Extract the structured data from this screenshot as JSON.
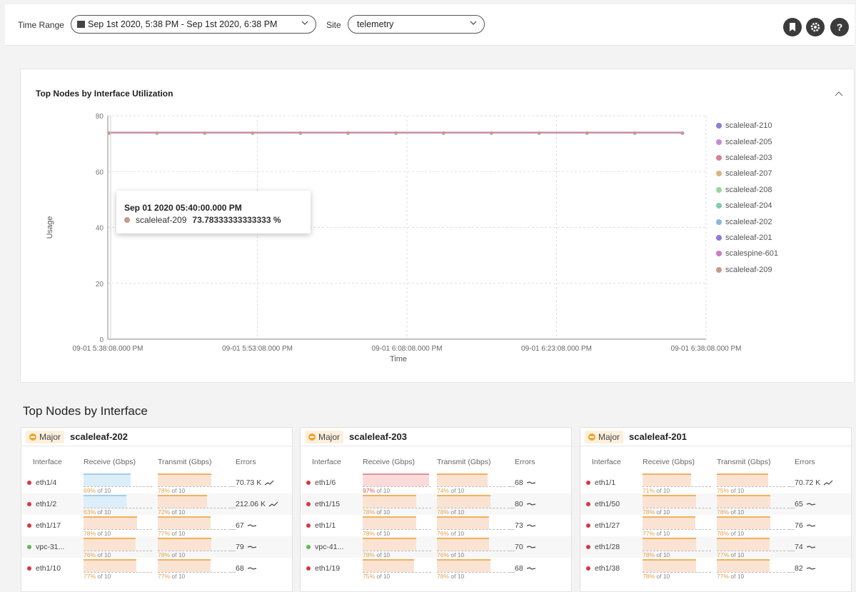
{
  "header": {
    "time_range_label": "Time Range",
    "time_range_value": "Sep 1st 2020, 5:38 PM - Sep 1st 2020, 6:38 PM",
    "site_label": "Site",
    "site_value": "telemetry",
    "icons": [
      "bookmark-icon",
      "gear-icon",
      "help-icon"
    ]
  },
  "chart_card": {
    "title": "Top Nodes by Interface Utilization"
  },
  "chart_data": {
    "type": "line",
    "xlabel": "Time",
    "ylabel": "Usage",
    "ylim": [
      0,
      80
    ],
    "yticks": [
      0,
      20,
      40,
      60,
      80
    ],
    "xticks": [
      "09-01 5:38:08.000 PM",
      "09-01 5:53:08.000 PM",
      "09-01 6:08:08.000 PM",
      "09-01 6:23:08.000 PM",
      "09-01 6:38:08.000 PM"
    ],
    "grid": true,
    "legend_position": "right",
    "x": [
      "5:38:08 PM",
      "5:40:00 PM",
      "5:45:00 PM",
      "5:50:00 PM",
      "5:55:00 PM",
      "6:00:00 PM",
      "6:05:00 PM",
      "6:10:00 PM",
      "6:15:00 PM",
      "6:20:00 PM",
      "6:25:00 PM",
      "6:30:00 PM",
      "6:38:08 PM"
    ],
    "series": [
      {
        "name": "scaleleaf-210",
        "color": "#8a7fd0",
        "values": [
          74,
          74,
          74,
          74,
          74,
          74,
          74,
          74,
          74,
          74,
          74,
          74,
          74
        ]
      },
      {
        "name": "scaleleaf-205",
        "color": "#c18cd6",
        "values": [
          74,
          74,
          74,
          74,
          74,
          74,
          74,
          74,
          74,
          74,
          74,
          74,
          74
        ]
      },
      {
        "name": "scaleleaf-203",
        "color": "#d98098",
        "values": [
          74,
          74,
          74,
          74,
          74,
          74,
          74,
          74,
          74,
          74,
          74,
          74,
          74
        ]
      },
      {
        "name": "scaleleaf-207",
        "color": "#d9b483",
        "values": [
          74,
          74,
          74,
          74,
          74,
          74,
          74,
          74,
          74,
          74,
          74,
          74,
          74
        ]
      },
      {
        "name": "scaleleaf-208",
        "color": "#9fd39a",
        "values": [
          74,
          74,
          74,
          74,
          74,
          74,
          74,
          74,
          74,
          74,
          74,
          74,
          74
        ]
      },
      {
        "name": "scaleleaf-204",
        "color": "#7fcfa8",
        "values": [
          74,
          74,
          74,
          74,
          74,
          74,
          74,
          74,
          74,
          74,
          74,
          74,
          74
        ]
      },
      {
        "name": "scaleleaf-202",
        "color": "#83b9dd",
        "values": [
          74,
          74,
          74,
          74,
          74,
          74,
          74,
          74,
          74,
          74,
          74,
          74,
          74
        ]
      },
      {
        "name": "scaleleaf-201",
        "color": "#8f79d6",
        "values": [
          74,
          74,
          74,
          74,
          74,
          74,
          74,
          74,
          74,
          74,
          74,
          74,
          74
        ]
      },
      {
        "name": "scalespine-601",
        "color": "#d37ac4",
        "values": [
          74,
          74,
          74,
          74,
          74,
          74,
          74,
          74,
          74,
          74,
          74,
          74,
          74
        ]
      },
      {
        "name": "scaleleaf-209",
        "color": "#c79a8a",
        "values": [
          73.78,
          73.78,
          73.78,
          73.78,
          73.78,
          73.78,
          73.78,
          73.78,
          73.78,
          73.78,
          73.78,
          73.78,
          73.78
        ]
      }
    ]
  },
  "tooltip": {
    "time": "Sep 01 2020 05:40:00.000 PM",
    "series": "scaleleaf-209",
    "value": "73.78333333333333 %",
    "color": "#c79a8a"
  },
  "nodes_section": {
    "title": "Top Nodes by Interface",
    "columns": [
      "Interface",
      "Receive (Gbps)",
      "Transmit (Gbps)",
      "Errors"
    ],
    "nodes": [
      {
        "severity": "Major",
        "name": "scaleleaf-202",
        "rows": [
          {
            "iface": "eth1/4",
            "status": "red",
            "rx_pct": "69%",
            "rx_of": " of 10",
            "rx_val": 0.69,
            "rx_color": "blue",
            "tx_pct": "78%",
            "tx_of": " of 10",
            "tx_val": 0.78,
            "errors": "70.73 K",
            "trend": "up"
          },
          {
            "iface": "eth1/2",
            "status": "red",
            "rx_pct": "63%",
            "rx_of": " of 10",
            "rx_val": 0.63,
            "rx_color": "blue",
            "tx_pct": "72%",
            "tx_of": " of 10",
            "tx_val": 0.72,
            "errors": "212.06 K",
            "trend": "up"
          },
          {
            "iface": "eth1/17",
            "status": "red",
            "rx_pct": "78%",
            "rx_of": " of 10",
            "rx_val": 0.78,
            "rx_color": "orange",
            "tx_pct": "77%",
            "tx_of": " of 10",
            "tx_val": 0.77,
            "errors": "67",
            "trend": "flat"
          },
          {
            "iface": "vpc-31...",
            "status": "green",
            "rx_pct": "76%",
            "rx_of": " of 10",
            "rx_val": 0.76,
            "rx_color": "orange",
            "tx_pct": "78%",
            "tx_of": " of 10",
            "tx_val": 0.78,
            "errors": "79",
            "trend": "flat"
          },
          {
            "iface": "eth1/10",
            "status": "red",
            "rx_pct": "77%",
            "rx_of": " of 10",
            "rx_val": 0.77,
            "rx_color": "orange",
            "tx_pct": "77%",
            "tx_of": " of 10",
            "tx_val": 0.77,
            "errors": "68",
            "trend": "flat"
          }
        ]
      },
      {
        "severity": "Major",
        "name": "scaleleaf-203",
        "rows": [
          {
            "iface": "eth1/6",
            "status": "red",
            "rx_pct": "97%",
            "rx_of": " of 10",
            "rx_val": 0.97,
            "rx_color": "red",
            "tx_pct": "74%",
            "tx_of": " of 10",
            "tx_val": 0.74,
            "errors": "68",
            "trend": "flat"
          },
          {
            "iface": "eth1/15",
            "status": "red",
            "rx_pct": "78%",
            "rx_of": " of 10",
            "rx_val": 0.78,
            "rx_color": "orange",
            "tx_pct": "78%",
            "tx_of": " of 10",
            "tx_val": 0.78,
            "errors": "80",
            "trend": "flat"
          },
          {
            "iface": "eth1/1",
            "status": "red",
            "rx_pct": "78%",
            "rx_of": " of 10",
            "rx_val": 0.78,
            "rx_color": "orange",
            "tx_pct": "76%",
            "tx_of": " of 10",
            "tx_val": 0.76,
            "errors": "73",
            "trend": "flat"
          },
          {
            "iface": "vpc-41...",
            "status": "green",
            "rx_pct": "78%",
            "rx_of": " of 10",
            "rx_val": 0.78,
            "rx_color": "orange",
            "tx_pct": "76%",
            "tx_of": " of 10",
            "tx_val": 0.76,
            "errors": "70",
            "trend": "flat"
          },
          {
            "iface": "eth1/19",
            "status": "red",
            "rx_pct": "75%",
            "rx_of": " of 10",
            "rx_val": 0.75,
            "rx_color": "orange",
            "tx_pct": "78%",
            "tx_of": " of 10",
            "tx_val": 0.78,
            "errors": "68",
            "trend": "flat"
          }
        ]
      },
      {
        "severity": "Major",
        "name": "scaleleaf-201",
        "rows": [
          {
            "iface": "eth1/1",
            "status": "red",
            "rx_pct": "71%",
            "rx_of": " of 10",
            "rx_val": 0.71,
            "rx_color": "orange",
            "tx_pct": "75%",
            "tx_of": " of 10",
            "tx_val": 0.75,
            "errors": "70.72 K",
            "trend": "up"
          },
          {
            "iface": "eth1/50",
            "status": "red",
            "rx_pct": "78%",
            "rx_of": " of 10",
            "rx_val": 0.78,
            "rx_color": "orange",
            "tx_pct": "78%",
            "tx_of": " of 10",
            "tx_val": 0.78,
            "errors": "65",
            "trend": "flat"
          },
          {
            "iface": "eth1/27",
            "status": "red",
            "rx_pct": "77%",
            "rx_of": " of 10",
            "rx_val": 0.77,
            "rx_color": "orange",
            "tx_pct": "78%",
            "tx_of": " of 10",
            "tx_val": 0.78,
            "errors": "76",
            "trend": "flat"
          },
          {
            "iface": "eth1/28",
            "status": "red",
            "rx_pct": "78%",
            "rx_of": " of 10",
            "rx_val": 0.78,
            "rx_color": "orange",
            "tx_pct": "77%",
            "tx_of": " of 10",
            "tx_val": 0.77,
            "errors": "74",
            "trend": "flat"
          },
          {
            "iface": "eth1/38",
            "status": "red",
            "rx_pct": "78%",
            "rx_of": " of 10",
            "rx_val": 0.78,
            "rx_color": "orange",
            "tx_pct": "77%",
            "tx_of": " of 10",
            "tx_val": 0.77,
            "errors": "82",
            "trend": "flat"
          }
        ]
      }
    ]
  }
}
